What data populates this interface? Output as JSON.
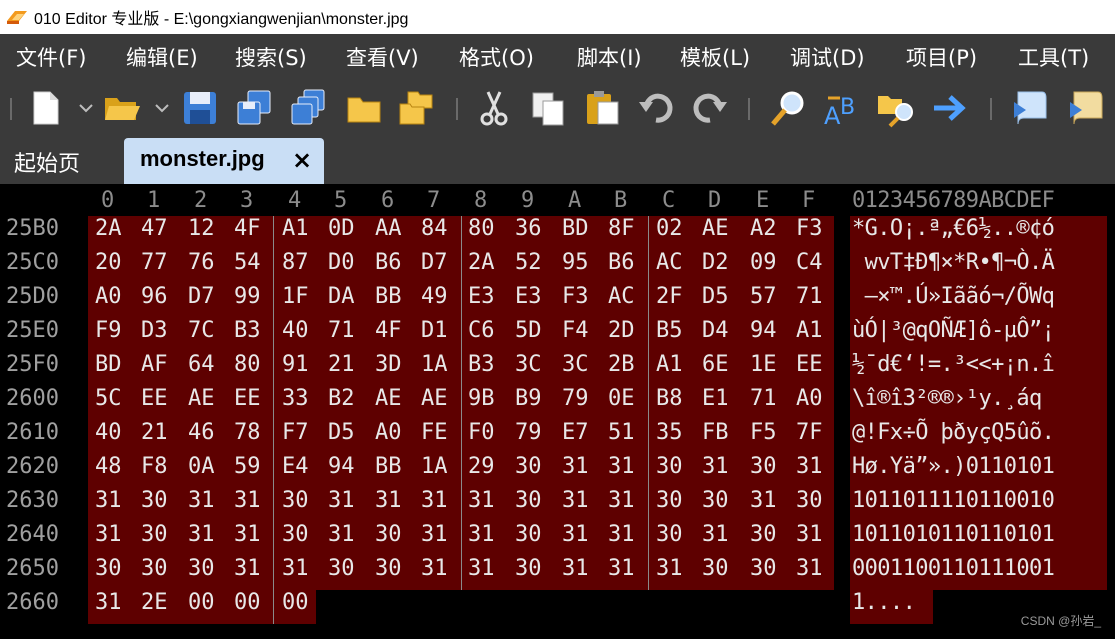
{
  "window": {
    "title": "010 Editor 专业版 - E:\\gongxiangwenjian\\monster.jpg"
  },
  "menu": [
    "文件(F)",
    "编辑(E)",
    "搜索(S)",
    "查看(V)",
    "格式(O)",
    "脚本(I)",
    "模板(L)",
    "调试(D)",
    "项目(P)",
    "工具(T)"
  ],
  "toolbar": {
    "icons": [
      "new-file-icon",
      "open-folder-icon",
      "save-icon",
      "save-as-icon",
      "save-all-icon",
      "folder-icon",
      "open-workspace-icon",
      "cut-icon",
      "copy-icon",
      "paste-icon",
      "undo-icon",
      "redo-icon",
      "find-icon",
      "replace-icon",
      "find-in-files-icon",
      "goto-icon",
      "run-script-icon",
      "run-template-icon"
    ]
  },
  "tabs": {
    "start": "起始页",
    "active": "monster.jpg",
    "close": "×"
  },
  "hex": {
    "column_headers": [
      "0",
      "1",
      "2",
      "3",
      "4",
      "5",
      "6",
      "7",
      "8",
      "9",
      "A",
      "B",
      "C",
      "D",
      "E",
      "F"
    ],
    "ascii_header": "0123456789ABCDEF",
    "rows": [
      {
        "addr": "25B0",
        "bytes": [
          "2A",
          "47",
          "12",
          "4F",
          "A1",
          "0D",
          "AA",
          "84",
          "80",
          "36",
          "BD",
          "8F",
          "02",
          "AE",
          "A2",
          "F3"
        ],
        "ascii": "*G.O¡.ª„€6½..®¢ó"
      },
      {
        "addr": "25C0",
        "bytes": [
          "20",
          "77",
          "76",
          "54",
          "87",
          "D0",
          "B6",
          "D7",
          "2A",
          "52",
          "95",
          "B6",
          "AC",
          "D2",
          "09",
          "C4"
        ],
        "ascii": " wvT‡Ð¶×*R•¶¬Ò.Ä"
      },
      {
        "addr": "25D0",
        "bytes": [
          "A0",
          "96",
          "D7",
          "99",
          "1F",
          "DA",
          "BB",
          "49",
          "E3",
          "E3",
          "F3",
          "AC",
          "2F",
          "D5",
          "57",
          "71"
        ],
        "ascii": " –×™.Ú»Iããó¬/ÕWq"
      },
      {
        "addr": "25E0",
        "bytes": [
          "F9",
          "D3",
          "7C",
          "B3",
          "40",
          "71",
          "4F",
          "D1",
          "C6",
          "5D",
          "F4",
          "2D",
          "B5",
          "D4",
          "94",
          "A1"
        ],
        "ascii": "ùÓ|³@qOÑÆ]ô-µÔ”¡"
      },
      {
        "addr": "25F0",
        "bytes": [
          "BD",
          "AF",
          "64",
          "80",
          "91",
          "21",
          "3D",
          "1A",
          "B3",
          "3C",
          "3C",
          "2B",
          "A1",
          "6E",
          "1E",
          "EE"
        ],
        "ascii": "½¯d€‘!=.³<<+¡n.î"
      },
      {
        "addr": "2600",
        "bytes": [
          "5C",
          "EE",
          "AE",
          "EE",
          "33",
          "B2",
          "AE",
          "AE",
          "9B",
          "B9",
          "79",
          "0E",
          "B8",
          "E1",
          "71",
          "A0"
        ],
        "ascii": "\\î®î3²®®›¹y.¸áq "
      },
      {
        "addr": "2610",
        "bytes": [
          "40",
          "21",
          "46",
          "78",
          "F7",
          "D5",
          "A0",
          "FE",
          "F0",
          "79",
          "E7",
          "51",
          "35",
          "FB",
          "F5",
          "7F"
        ],
        "ascii": "@!Fx÷Õ þðyçQ5ûõ."
      },
      {
        "addr": "2620",
        "bytes": [
          "48",
          "F8",
          "0A",
          "59",
          "E4",
          "94",
          "BB",
          "1A",
          "29",
          "30",
          "31",
          "31",
          "30",
          "31",
          "30",
          "31"
        ],
        "ascii": "Hø.Yä”».)0110101"
      },
      {
        "addr": "2630",
        "bytes": [
          "31",
          "30",
          "31",
          "31",
          "30",
          "31",
          "31",
          "31",
          "31",
          "30",
          "31",
          "31",
          "30",
          "30",
          "31",
          "30"
        ],
        "ascii": "1011011110110010"
      },
      {
        "addr": "2640",
        "bytes": [
          "31",
          "30",
          "31",
          "31",
          "30",
          "31",
          "30",
          "31",
          "31",
          "30",
          "31",
          "31",
          "30",
          "31",
          "30",
          "31"
        ],
        "ascii": "1011010110110101"
      },
      {
        "addr": "2650",
        "bytes": [
          "30",
          "30",
          "30",
          "31",
          "31",
          "30",
          "30",
          "31",
          "31",
          "30",
          "31",
          "31",
          "31",
          "30",
          "30",
          "31"
        ],
        "ascii": "0001100110111001"
      },
      {
        "addr": "2660",
        "bytes": [
          "31",
          "2E",
          "00",
          "00",
          "00"
        ],
        "ascii": "1...."
      }
    ]
  },
  "watermark": "CSDN @孙岩_"
}
